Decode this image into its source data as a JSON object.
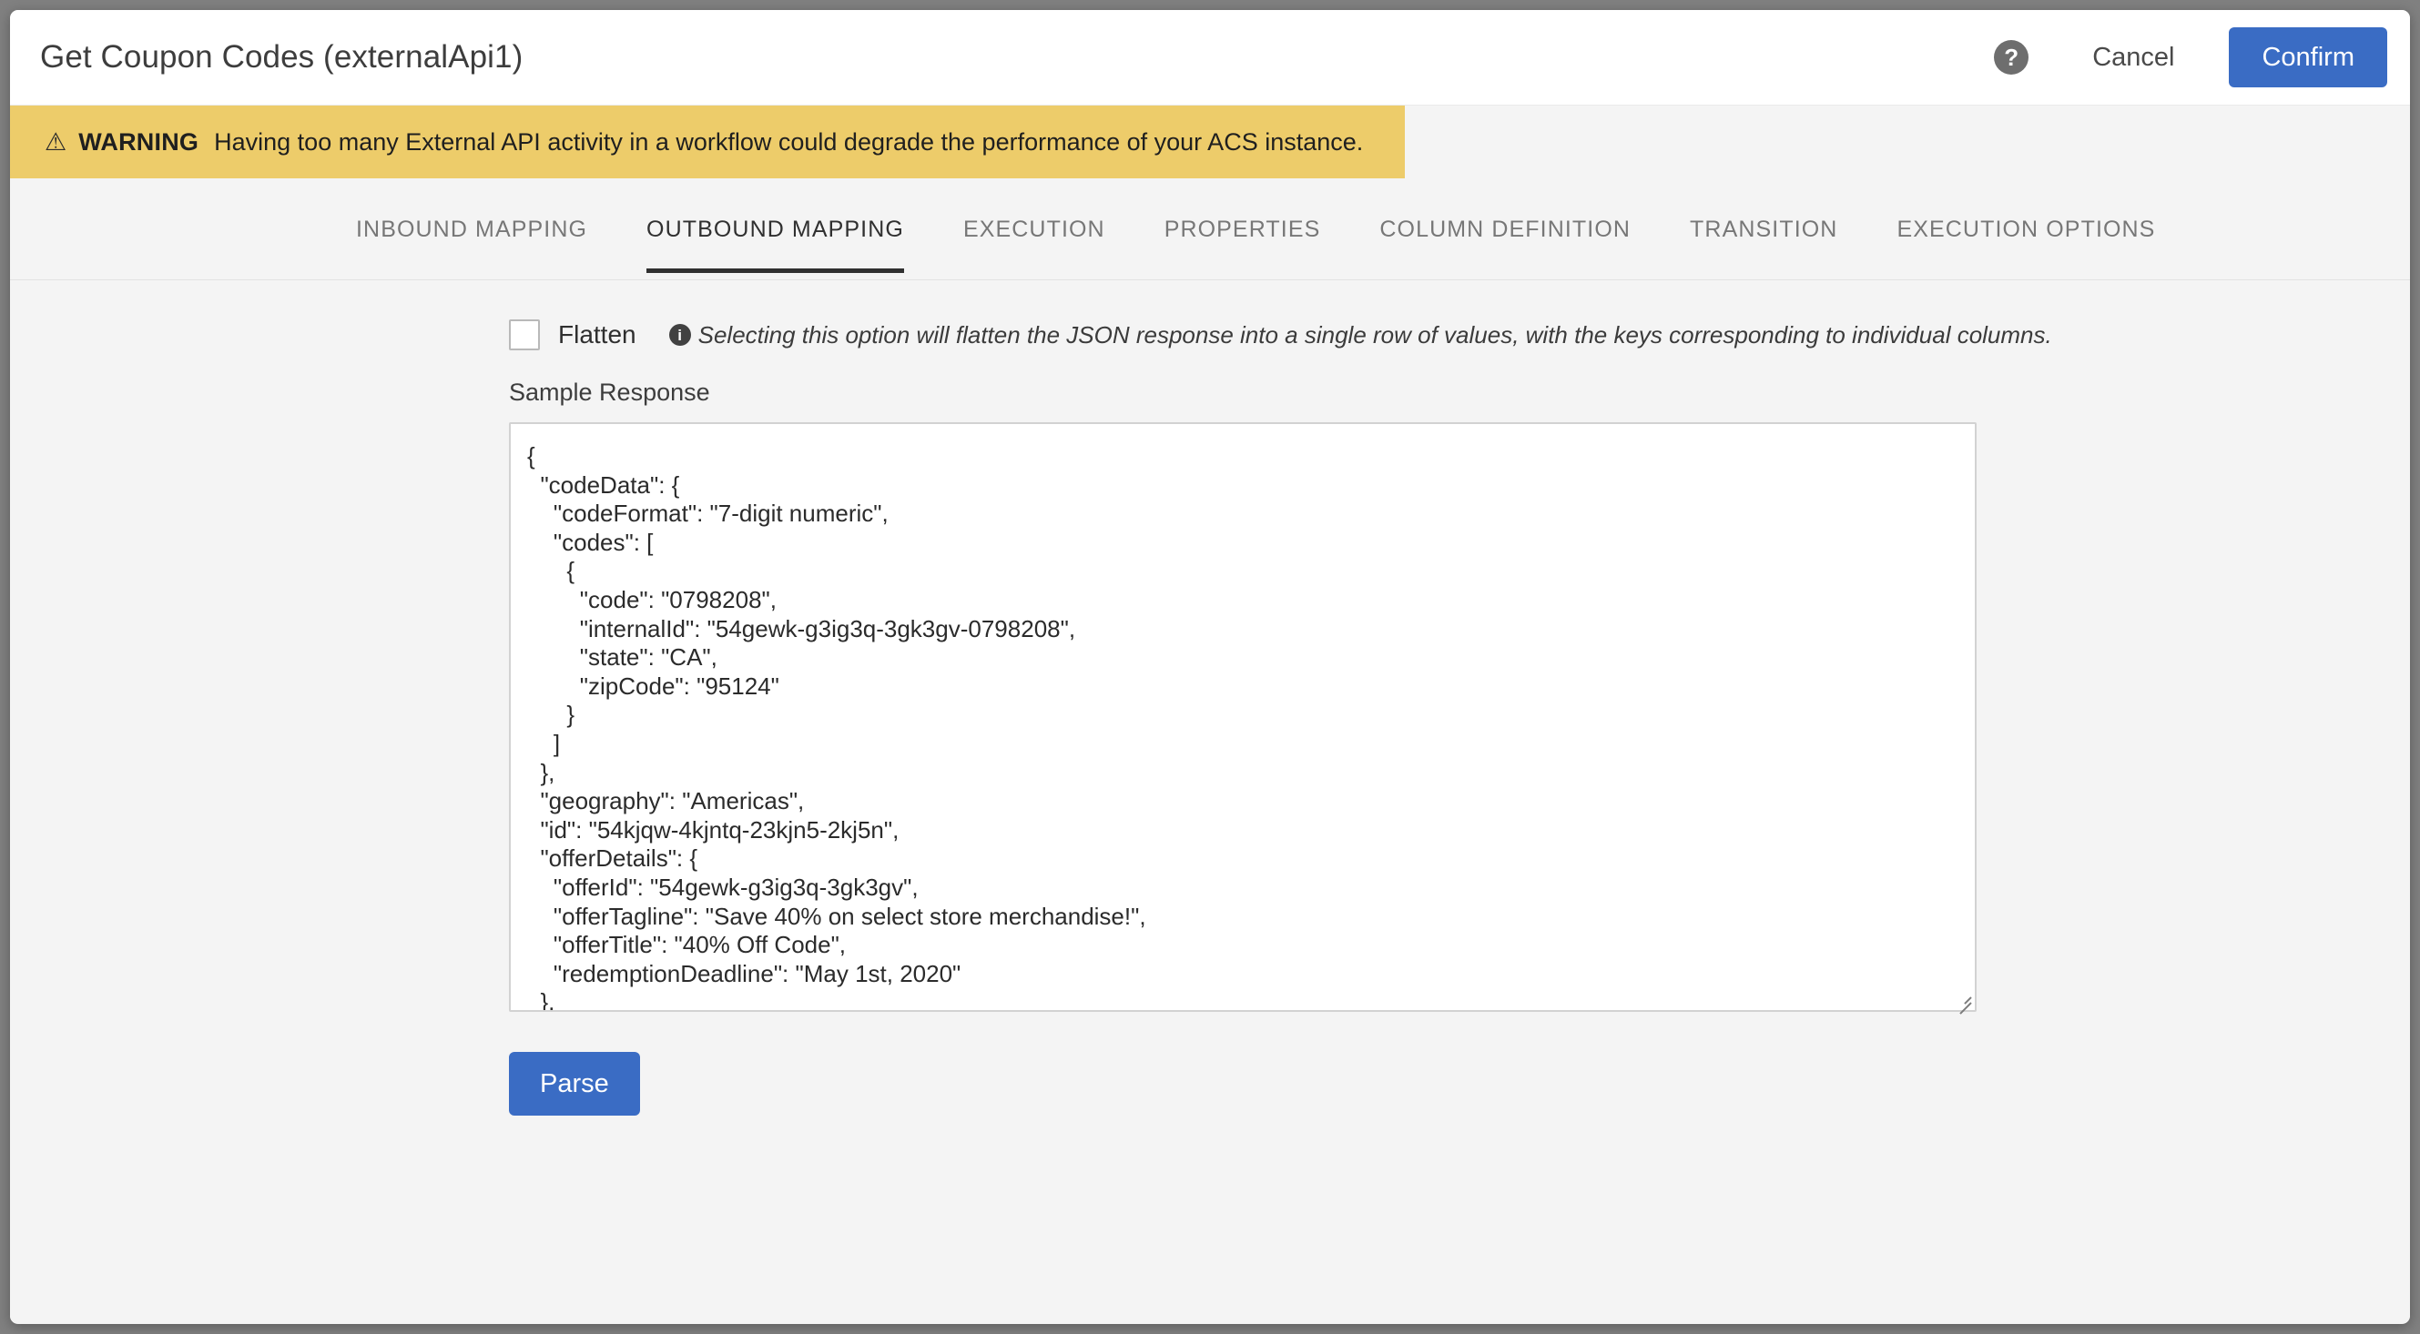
{
  "titlebar": {
    "title": "Get Coupon Codes (externalApi1)",
    "help_icon": "help-circle-icon",
    "cancel_label": "Cancel",
    "confirm_label": "Confirm",
    "confirm_color": "#3a6cc4"
  },
  "warning": {
    "icon": "warning-triangle-icon",
    "label": "WARNING",
    "message": "Having too many External API activity in a workflow could degrade the performance of your ACS instance.",
    "background_color": "#edcc6a"
  },
  "tabs": [
    {
      "label": "INBOUND MAPPING",
      "active": false
    },
    {
      "label": "OUTBOUND MAPPING",
      "active": true
    },
    {
      "label": "EXECUTION",
      "active": false
    },
    {
      "label": "PROPERTIES",
      "active": false
    },
    {
      "label": "COLUMN DEFINITION",
      "active": false
    },
    {
      "label": "TRANSITION",
      "active": false
    },
    {
      "label": "EXECUTION OPTIONS",
      "active": false
    }
  ],
  "form": {
    "flatten_checked": false,
    "flatten_label": "Flatten",
    "info_icon": "info-circle-icon",
    "flatten_hint": "Selecting this option will flatten the JSON response into a single row of values, with the keys corresponding to individual columns.",
    "sample_response_label": "Sample Response",
    "sample_response_value": "{\n  \"codeData\": {\n    \"codeFormat\": \"7-digit numeric\",\n    \"codes\": [\n      {\n        \"code\": \"0798208\",\n        \"internalId\": \"54gewk-g3ig3q-3gk3gv-0798208\",\n        \"state\": \"CA\",\n        \"zipCode\": \"95124\"\n      }\n    ]\n  },\n  \"geography\": \"Americas\",\n  \"id\": \"54kjqw-4kjntq-23kjn5-2kj5n\",\n  \"offerDetails\": {\n    \"offerId\": \"54gewk-g3ig3q-3gk3gv\",\n    \"offerTagline\": \"Save 40% on select store merchandise!\",\n    \"offerTitle\": \"40% Off Code\",\n    \"redemptionDeadline\": \"May 1st, 2020\"\n  },",
    "parse_label": "Parse"
  }
}
